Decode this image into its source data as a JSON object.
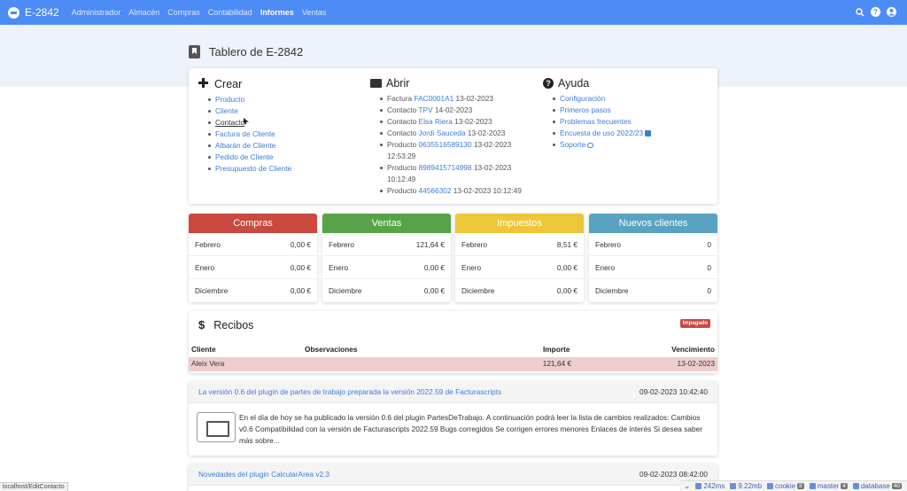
{
  "navbar": {
    "brand": "E-2842",
    "items": [
      "Administrador",
      "Almacén",
      "Compras",
      "Contabilidad",
      "Informes",
      "Ventas"
    ],
    "active": "Informes",
    "help_glyph": "?",
    "user_glyph": "●",
    "search_glyph": "⌕"
  },
  "page": {
    "title": "Tablero de E-2842"
  },
  "crear": {
    "title": "Crear",
    "items": [
      "Producto",
      "Cliente",
      "Contacto",
      "Factura de Cliente",
      "Albarán de Cliente",
      "Pedido de Cliente",
      "Presupuesto de Cliente"
    ]
  },
  "abrir": {
    "title": "Abrir",
    "items": [
      {
        "type": "Factura",
        "link": "FAC0001A1",
        "date": "13-02-2023"
      },
      {
        "type": "Contacto",
        "link": "TPV",
        "date": "14-02-2023"
      },
      {
        "type": "Contacto",
        "link": "Elsa Riera",
        "date": "13-02-2023"
      },
      {
        "type": "Contacto",
        "link": "Jordi Sauceda",
        "date": "13-02-2023"
      },
      {
        "type": "Producto",
        "link": "0635516589130",
        "date": "13-02-2023",
        "time": "12:53:29"
      },
      {
        "type": "Producto",
        "link": "8989415714998",
        "date": "13-02-2023",
        "time": "10:12:49"
      },
      {
        "type": "Producto",
        "link": "44566302",
        "date": "13-02-2023 10:12:49"
      }
    ]
  },
  "ayuda": {
    "title": "Ayuda",
    "items": [
      "Configuración",
      "Primeros pasos",
      "Problemas frecuentes",
      "Encuesta de uso 2022/23",
      "Soporte"
    ]
  },
  "stats": [
    {
      "title": "Compras",
      "color": "#c9483f",
      "rows": [
        {
          "label": "Febrero",
          "value": "0,00 €"
        },
        {
          "label": "Enero",
          "value": "0,00 €"
        },
        {
          "label": "Diciembre",
          "value": "0,00 €"
        }
      ]
    },
    {
      "title": "Ventas",
      "color": "#56a447",
      "rows": [
        {
          "label": "Febrero",
          "value": "121,64 €"
        },
        {
          "label": "Enero",
          "value": "0,00 €"
        },
        {
          "label": "Diciembre",
          "value": "0,00 €"
        }
      ]
    },
    {
      "title": "Impuestos",
      "color": "#eec639",
      "rows": [
        {
          "label": "Febrero",
          "value": "8,51 €"
        },
        {
          "label": "Enero",
          "value": "0,00 €"
        },
        {
          "label": "Diciembre",
          "value": "0,00 €"
        }
      ]
    },
    {
      "title": "Nuevos clientes",
      "color": "#59a3c0",
      "rows": [
        {
          "label": "Febrero",
          "value": "0"
        },
        {
          "label": "Enero",
          "value": "0"
        },
        {
          "label": "Diciembre",
          "value": "0"
        }
      ]
    }
  ],
  "recibos": {
    "title": "Recibos",
    "badge": "Impagado",
    "headers": {
      "cliente": "Cliente",
      "observaciones": "Observaciones",
      "importe": "Importe",
      "vencimiento": "Vencimiento"
    },
    "rows": [
      {
        "cliente": "Aleix Vera",
        "observaciones": "",
        "importe": "121,64 €",
        "vencimiento": "13-02-2023"
      }
    ]
  },
  "news": [
    {
      "title": "La versión 0.6 del plugin de partes de trabajo preparada la versión 2022.59 de Facturascripts",
      "date": "09-02-2023 10:42:40",
      "body": "En el día de hoy se ha publicado la versión 0.6 del plugin PartesDeTrabajo. A continuación podrá leer la lista de cambios realizados: Cambios v0.6 Compatibilidad con la versión de Facturascripts 2022.59 Bugs corregidos Se corrigen errores menores Enlaces de interés Si desea saber más sobre..."
    },
    {
      "title": "Novedades del plugin CalcularArea v2.3",
      "date": "09-02-2023 08:42:00"
    }
  ],
  "status_url": "localhost/EditContacto",
  "debugbar": {
    "time": "242ms",
    "memory": "9.22mb",
    "cookie_label": "cookie",
    "cookie_count": "8",
    "master_label": "master",
    "master_count": "4",
    "database_label": "database",
    "database_count": "40"
  }
}
